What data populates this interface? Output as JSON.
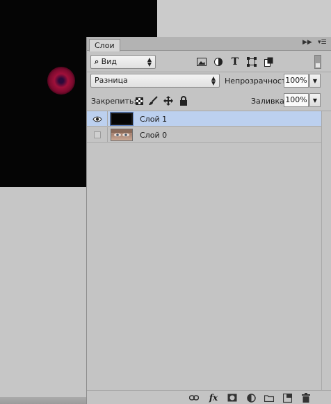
{
  "panel": {
    "tab_label": "Слои",
    "filter_select": {
      "label": "Вид",
      "icon": "search-icon"
    },
    "filter_icons": [
      "image-filter-icon",
      "adjustment-filter-icon",
      "type-filter-icon",
      "shape-filter-icon",
      "smart-object-filter-icon"
    ],
    "blend_mode": "Разница",
    "opacity_label": "Непрозрачность:",
    "opacity_value": "100%",
    "lock_label": "Закрепить:",
    "lock_icons": [
      "lock-transparent-icon",
      "lock-paint-icon",
      "lock-move-icon",
      "lock-all-icon"
    ],
    "fill_label": "Заливка:",
    "fill_value": "100%",
    "layers": [
      {
        "name": "Слой 1",
        "visible": true,
        "selected": true,
        "thumb": "black"
      },
      {
        "name": "Слой 0",
        "visible": false,
        "selected": false,
        "thumb": "eyes"
      }
    ],
    "footer_icons": [
      "link-icon",
      "fx-icon",
      "mask-icon",
      "adjustment-layer-icon",
      "folder-icon",
      "new-layer-icon",
      "trash-icon"
    ]
  },
  "colors": {
    "selected_row": "#bcd0ef",
    "glow": "#a0103a"
  }
}
